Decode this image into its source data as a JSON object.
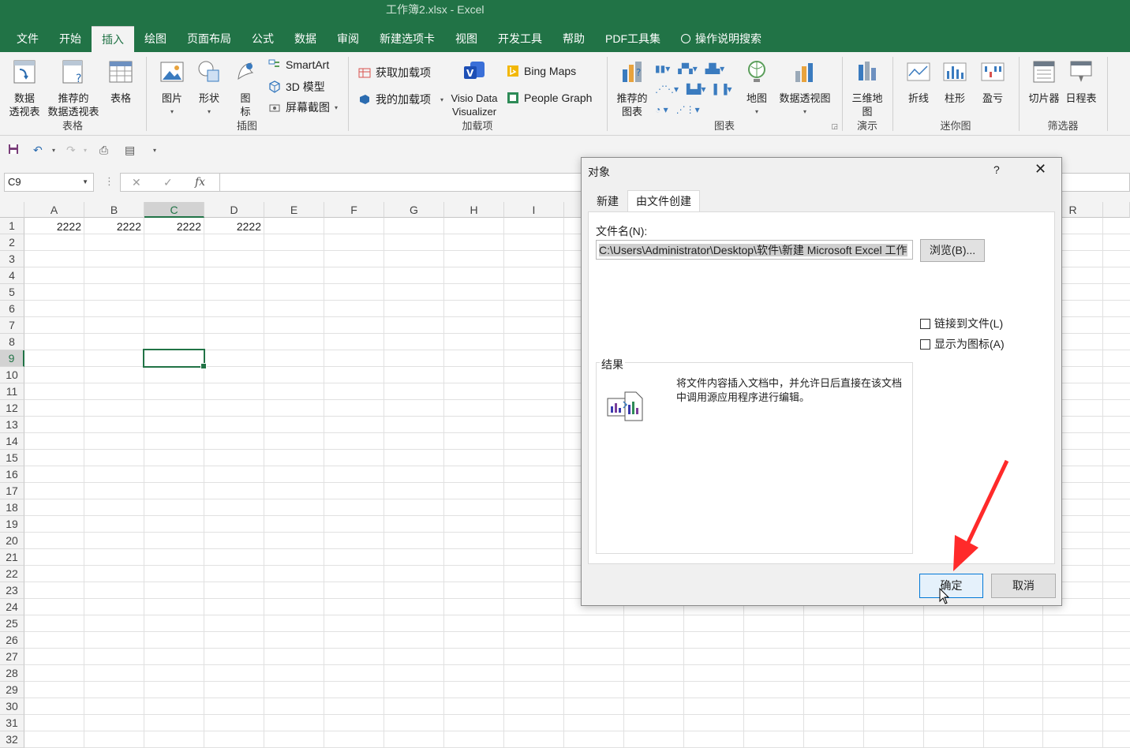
{
  "window": {
    "title": "工作簿2.xlsx  -  Excel"
  },
  "menu": {
    "tabs": [
      "文件",
      "开始",
      "插入",
      "绘图",
      "页面布局",
      "公式",
      "数据",
      "审阅",
      "新建选项卡",
      "视图",
      "开发工具",
      "帮助",
      "PDF工具集"
    ],
    "search": "操作说明搜索",
    "active": "插入"
  },
  "ribbon": {
    "groups": {
      "tables": "表格",
      "illustrations": "插图",
      "addins": "加载项",
      "charts": "图表",
      "tours": "演示",
      "sparklines": "迷你图",
      "filters": "筛选器"
    },
    "buttons": {
      "pivot": "数据\n透视表",
      "recommended_pivot": "推荐的\n数据透视表",
      "table": "表格",
      "pictures": "图片",
      "shapes": "形状",
      "icons": "图\n标",
      "smartart": "SmartArt",
      "model3d": "3D 模型",
      "screenshot": "屏幕截图",
      "get_addins": "获取加载项",
      "my_addins": "我的加载项",
      "visio": "Visio Data\nVisualizer",
      "bing_maps": "Bing Maps",
      "people_graph": "People Graph",
      "recommended_charts": "推荐的\n图表",
      "maps": "地图",
      "pivot_chart": "数据透视图",
      "map3d": "三维地\n图",
      "line": "折线",
      "column": "柱形",
      "winloss": "盈亏",
      "slicer": "切片器",
      "timeline": "日程表"
    }
  },
  "formula_bar": {
    "name_box": "C9",
    "fx": "fx",
    "value": ""
  },
  "sheet": {
    "columns": [
      "A",
      "B",
      "C",
      "D",
      "E",
      "F",
      "G",
      "H",
      "I",
      "R"
    ],
    "selected_column": "C",
    "selected_row": 9,
    "rows": [
      "1",
      "2",
      "3",
      "4",
      "5",
      "6",
      "7",
      "8",
      "9",
      "10",
      "11",
      "12",
      "13",
      "14",
      "15",
      "16",
      "17",
      "18",
      "19",
      "20",
      "21",
      "22",
      "23",
      "24",
      "25",
      "26",
      "27",
      "28",
      "29",
      "30",
      "31",
      "32"
    ],
    "row1": [
      "2222",
      "2222",
      "2222",
      "2222"
    ]
  },
  "dialog": {
    "title": "对象",
    "help": "?",
    "close": "✕",
    "tabs": [
      "新建",
      "由文件创建"
    ],
    "active_tab": "由文件创建",
    "filename_label": "文件名(N):",
    "filename_value": "C:\\Users\\Administrator\\Desktop\\软件\\新建 Microsoft Excel 工作",
    "browse": "浏览(B)...",
    "link_to_file": "链接到文件(L)",
    "display_as_icon": "显示为图标(A)",
    "result_label": "结果",
    "result_text": "将文件内容插入文档中，并允许日后直接在该文档中调用源应用程序进行编辑。",
    "ok": "确定",
    "cancel": "取消"
  }
}
